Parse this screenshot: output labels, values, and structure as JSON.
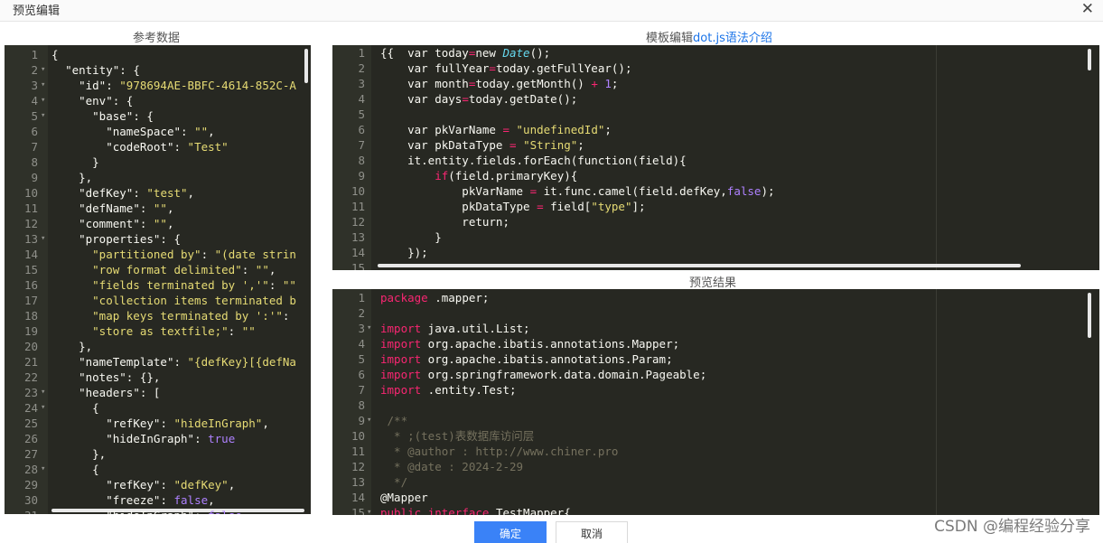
{
  "dialog": {
    "title": "预览编辑",
    "close_icon": "✕"
  },
  "left_panel": {
    "label": "参考数据",
    "lines": [
      [
        [
          "p",
          "{"
        ]
      ],
      [
        [
          "p",
          "  "
        ],
        [
          "p",
          "\"entity\""
        ],
        [
          "p",
          ": {"
        ]
      ],
      [
        [
          "p",
          "    "
        ],
        [
          "p",
          "\"id\""
        ],
        [
          "p",
          ": "
        ],
        [
          "s",
          "\"978694AE-BBFC-4614-852C-A"
        ]
      ],
      [
        [
          "p",
          "    "
        ],
        [
          "p",
          "\"env\""
        ],
        [
          "p",
          ": {"
        ]
      ],
      [
        [
          "p",
          "      "
        ],
        [
          "p",
          "\"base\""
        ],
        [
          "p",
          ": {"
        ]
      ],
      [
        [
          "p",
          "        "
        ],
        [
          "p",
          "\"nameSpace\""
        ],
        [
          "p",
          ": "
        ],
        [
          "s",
          "\"\""
        ],
        [
          "p",
          ","
        ]
      ],
      [
        [
          "p",
          "        "
        ],
        [
          "p",
          "\"codeRoot\""
        ],
        [
          "p",
          ": "
        ],
        [
          "s",
          "\"Test\""
        ]
      ],
      [
        [
          "p",
          "      }"
        ]
      ],
      [
        [
          "p",
          "    },"
        ]
      ],
      [
        [
          "p",
          "    "
        ],
        [
          "p",
          "\"defKey\""
        ],
        [
          "p",
          ": "
        ],
        [
          "s",
          "\"test\""
        ],
        [
          "p",
          ","
        ]
      ],
      [
        [
          "p",
          "    "
        ],
        [
          "p",
          "\"defName\""
        ],
        [
          "p",
          ": "
        ],
        [
          "s",
          "\"\""
        ],
        [
          "p",
          ","
        ]
      ],
      [
        [
          "p",
          "    "
        ],
        [
          "p",
          "\"comment\""
        ],
        [
          "p",
          ": "
        ],
        [
          "s",
          "\"\""
        ],
        [
          "p",
          ","
        ]
      ],
      [
        [
          "p",
          "    "
        ],
        [
          "p",
          "\"properties\""
        ],
        [
          "p",
          ": {"
        ]
      ],
      [
        [
          "p",
          "      "
        ],
        [
          "s",
          "\"partitioned by\""
        ],
        [
          "p",
          ": "
        ],
        [
          "s",
          "\"(date strin"
        ]
      ],
      [
        [
          "p",
          "      "
        ],
        [
          "s",
          "\"row format delimited\""
        ],
        [
          "p",
          ": "
        ],
        [
          "s",
          "\"\""
        ],
        [
          "p",
          ","
        ]
      ],
      [
        [
          "p",
          "      "
        ],
        [
          "s",
          "\"fields terminated by ','\""
        ],
        [
          "p",
          ": "
        ],
        [
          "s",
          "\"\""
        ]
      ],
      [
        [
          "p",
          "      "
        ],
        [
          "s",
          "\"collection items terminated b"
        ]
      ],
      [
        [
          "p",
          "      "
        ],
        [
          "s",
          "\"map keys terminated by ':'\""
        ],
        [
          "p",
          ":"
        ]
      ],
      [
        [
          "p",
          "      "
        ],
        [
          "s",
          "\"store as textfile;\""
        ],
        [
          "p",
          ": "
        ],
        [
          "s",
          "\"\""
        ]
      ],
      [
        [
          "p",
          "    },"
        ]
      ],
      [
        [
          "p",
          "    "
        ],
        [
          "p",
          "\"nameTemplate\""
        ],
        [
          "p",
          ": "
        ],
        [
          "s",
          "\"{defKey}[{defNa"
        ]
      ],
      [
        [
          "p",
          "    "
        ],
        [
          "p",
          "\"notes\""
        ],
        [
          "p",
          ": {},"
        ]
      ],
      [
        [
          "p",
          "    "
        ],
        [
          "p",
          "\"headers\""
        ],
        [
          "p",
          ": ["
        ]
      ],
      [
        [
          "p",
          "      {"
        ]
      ],
      [
        [
          "p",
          "        "
        ],
        [
          "p",
          "\"refKey\""
        ],
        [
          "p",
          ": "
        ],
        [
          "s",
          "\"hideInGraph\""
        ],
        [
          "p",
          ","
        ]
      ],
      [
        [
          "p",
          "        "
        ],
        [
          "p",
          "\"hideInGraph\""
        ],
        [
          "p",
          ": "
        ],
        [
          "n",
          "true"
        ]
      ],
      [
        [
          "p",
          "      },"
        ]
      ],
      [
        [
          "p",
          "      {"
        ]
      ],
      [
        [
          "p",
          "        "
        ],
        [
          "p",
          "\"refKey\""
        ],
        [
          "p",
          ": "
        ],
        [
          "s",
          "\"defKey\""
        ],
        [
          "p",
          ","
        ]
      ],
      [
        [
          "p",
          "        "
        ],
        [
          "p",
          "\"freeze\""
        ],
        [
          "p",
          ": "
        ],
        [
          "n",
          "false"
        ],
        [
          "p",
          ","
        ]
      ],
      [
        [
          "p",
          "        "
        ],
        [
          "p",
          "\"hideInGraph\""
        ],
        [
          "p",
          ": "
        ],
        [
          "n",
          "false"
        ]
      ]
    ],
    "fold_markers": [
      2,
      3,
      4,
      5,
      13,
      23,
      24,
      28
    ]
  },
  "template_panel": {
    "label_prefix": "模板编辑",
    "label_link": "dot.js语法介绍",
    "lines": [
      [
        [
          "p",
          "{{  var today"
        ],
        [
          "k",
          "="
        ],
        [
          "p",
          "new "
        ],
        [
          "f",
          "Date"
        ],
        [
          "p",
          "();"
        ]
      ],
      [
        [
          "p",
          "    var fullYear"
        ],
        [
          "k",
          "="
        ],
        [
          "p",
          "today.getFullYear();"
        ]
      ],
      [
        [
          "p",
          "    var month"
        ],
        [
          "k",
          "="
        ],
        [
          "p",
          "today.getMonth() "
        ],
        [
          "k",
          "+"
        ],
        [
          "p",
          " "
        ],
        [
          "n",
          "1"
        ],
        [
          "p",
          ";"
        ]
      ],
      [
        [
          "p",
          "    var days"
        ],
        [
          "k",
          "="
        ],
        [
          "p",
          "today.getDate();"
        ]
      ],
      [
        [
          "p",
          ""
        ]
      ],
      [
        [
          "p",
          "    var pkVarName "
        ],
        [
          "k",
          "="
        ],
        [
          "p",
          " "
        ],
        [
          "s",
          "\"undefinedId\""
        ],
        [
          "p",
          ";"
        ]
      ],
      [
        [
          "p",
          "    var pkDataType "
        ],
        [
          "k",
          "="
        ],
        [
          "p",
          " "
        ],
        [
          "s",
          "\"String\""
        ],
        [
          "p",
          ";"
        ]
      ],
      [
        [
          "p",
          "    it.entity.fields.forEach(function(field){"
        ]
      ],
      [
        [
          "p",
          "        "
        ],
        [
          "k",
          "if"
        ],
        [
          "p",
          "(field.primaryKey){"
        ]
      ],
      [
        [
          "p",
          "            pkVarName "
        ],
        [
          "k",
          "="
        ],
        [
          "p",
          " it.func.camel(field.defKey,"
        ],
        [
          "n",
          "false"
        ],
        [
          "p",
          ");"
        ]
      ],
      [
        [
          "p",
          "            pkDataType "
        ],
        [
          "k",
          "="
        ],
        [
          "p",
          " field["
        ],
        [
          "s",
          "\"type\""
        ],
        [
          "p",
          "];"
        ]
      ],
      [
        [
          "p",
          "            return;"
        ]
      ],
      [
        [
          "p",
          "        }"
        ]
      ],
      [
        [
          "p",
          "    });"
        ]
      ],
      [
        [
          "p",
          ""
        ]
      ]
    ]
  },
  "preview_panel": {
    "label": "预览结果",
    "lines": [
      [
        [
          "k",
          "package"
        ],
        [
          "p",
          " .mapper;"
        ]
      ],
      [
        [
          "p",
          ""
        ]
      ],
      [
        [
          "k",
          "import"
        ],
        [
          "p",
          " java.util.List;"
        ]
      ],
      [
        [
          "k",
          "import"
        ],
        [
          "p",
          " org.apache.ibatis.annotations.Mapper;"
        ]
      ],
      [
        [
          "k",
          "import"
        ],
        [
          "p",
          " org.apache.ibatis.annotations.Param;"
        ]
      ],
      [
        [
          "k",
          "import"
        ],
        [
          "p",
          " org.springframework.data.domain.Pageable;"
        ]
      ],
      [
        [
          "k",
          "import"
        ],
        [
          "p",
          " .entity.Test;"
        ]
      ],
      [
        [
          "p",
          ""
        ]
      ],
      [
        [
          "c",
          " /**"
        ]
      ],
      [
        [
          "c",
          "  * ;(test)表数据库访问层"
        ]
      ],
      [
        [
          "c",
          "  * @author : http://www.chiner.pro"
        ]
      ],
      [
        [
          "c",
          "  * @date : 2024-2-29"
        ]
      ],
      [
        [
          "c",
          "  */"
        ]
      ],
      [
        [
          "p",
          "@Mapper"
        ]
      ],
      [
        [
          "k",
          "public"
        ],
        [
          "p",
          " "
        ],
        [
          "k",
          "interface"
        ],
        [
          "p",
          " TestMapper{"
        ]
      ]
    ],
    "fold_markers": [
      3,
      9,
      15
    ]
  },
  "buttons": {
    "confirm": "确定",
    "cancel": "取消"
  },
  "watermark": "CSDN @编程经验分享"
}
